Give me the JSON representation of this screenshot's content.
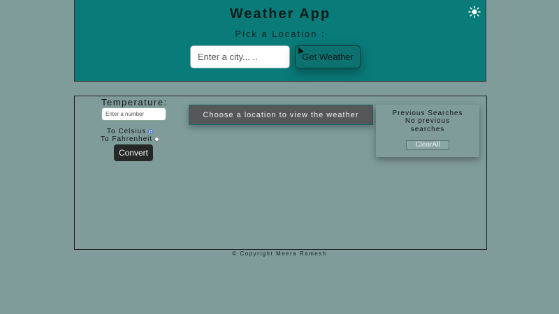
{
  "header": {
    "title": "Weather App",
    "pick_label": "Pick a Location :",
    "city_placeholder": "Enter a city... ..",
    "get_weather_label": "Get Weather",
    "theme_icon": "sun-icon"
  },
  "converter": {
    "label": "Temperature:",
    "number_placeholder": "Enter a number",
    "celsius_label": "To Celsius",
    "fahrenheit_label": "To Fahrenheit",
    "selected_option": "celsius",
    "convert_label": "Convert"
  },
  "weather": {
    "message": "Choose a location to view the weather"
  },
  "previous_searches": {
    "title": "Previous Searches",
    "empty_text": "No previous searches",
    "clear_label": "ClearAll"
  },
  "footer": {
    "text": "© Copyright Meera Ramesh"
  },
  "colors": {
    "background": "#7f9c9b",
    "header": "#097b79",
    "message_box": "#555758",
    "convert_button": "#262828"
  }
}
